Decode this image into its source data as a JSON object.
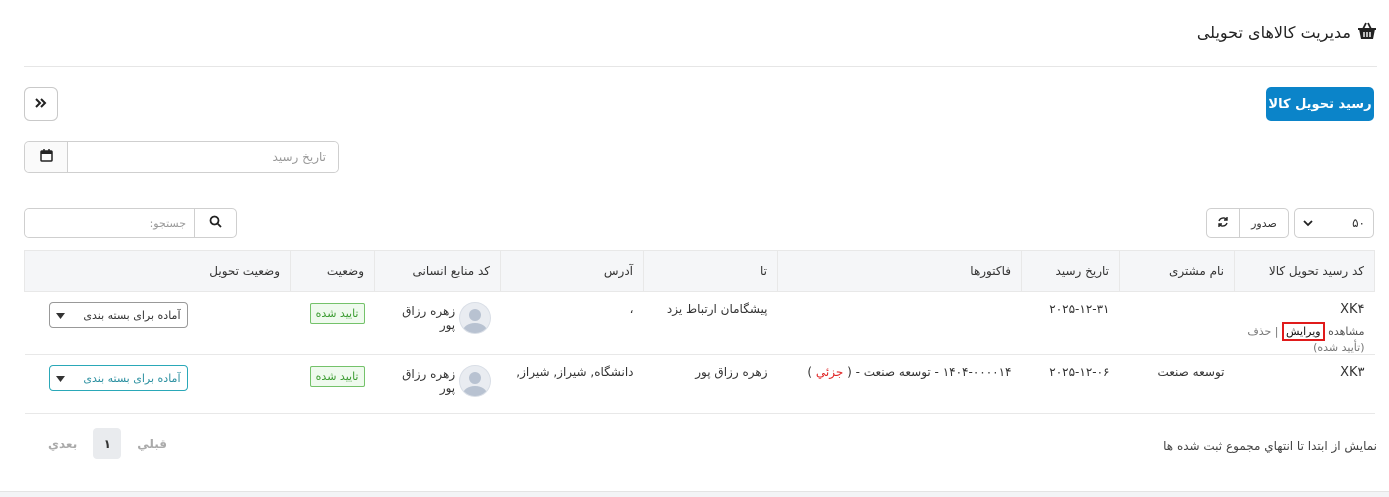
{
  "header": {
    "title": "مدیریت کالاهای تحویلی",
    "icon": "basket-icon"
  },
  "toolbar": {
    "primary_button": "رسید تحویل کالا",
    "collapse_icon": "double-chevron-icon"
  },
  "filters": {
    "date_placeholder": "تاریخ رسید",
    "search_placeholder": "جستجو:"
  },
  "table_controls": {
    "per_page": "۵۰",
    "export_label": "صدور"
  },
  "table": {
    "columns": [
      "کد رسید تحویل کالا",
      "نام مشتری",
      "تاریخ رسید",
      "فاکتورها",
      "تا",
      "آدرس",
      "کد منابع انسانی",
      "وضعیت",
      "وضعیت تحویل"
    ],
    "rows": [
      {
        "code": "XK۴",
        "actions": {
          "view": "مشاهده",
          "edit": "ویرایش",
          "delete": "| حذف (تأیید شده)"
        },
        "customer": "",
        "date": "۲۰۲۵-۱۲-۳۱",
        "invoices": "",
        "partial": "",
        "to": "پیشگامان ارتباط یزد",
        "address": "،",
        "hr_name": "زهره رزاق پور",
        "status": "تایید شده",
        "delivery_status": "آماده برای بسته بندی"
      },
      {
        "code": "XK۳",
        "actions": null,
        "customer": "توسعه صنعت",
        "date": "۲۰۲۵-۱۲-۰۶",
        "invoices": "۱۴۰۴-۰۰۰۰۱۴ - توسعه صنعت - (",
        "partial": " جزئي ",
        "to": "زهره رزاق پور",
        "address": "دانشگاه, شیراز, شیراز,",
        "hr_name": "زهره رزاق پور",
        "status": "تایید شده",
        "delivery_status": "آماده برای بسته بندی"
      }
    ]
  },
  "footer": {
    "info": "نمايش از ابتدا تا انتهاي مجموع ثبت شده ها",
    "prev": "قبلي",
    "current_page": "۱",
    "next": "بعدي"
  },
  "colors": {
    "primary": "#0b84c9",
    "success": "#3b9c31",
    "highlight": "#e01b1b",
    "teal": "#2aa8b8"
  }
}
